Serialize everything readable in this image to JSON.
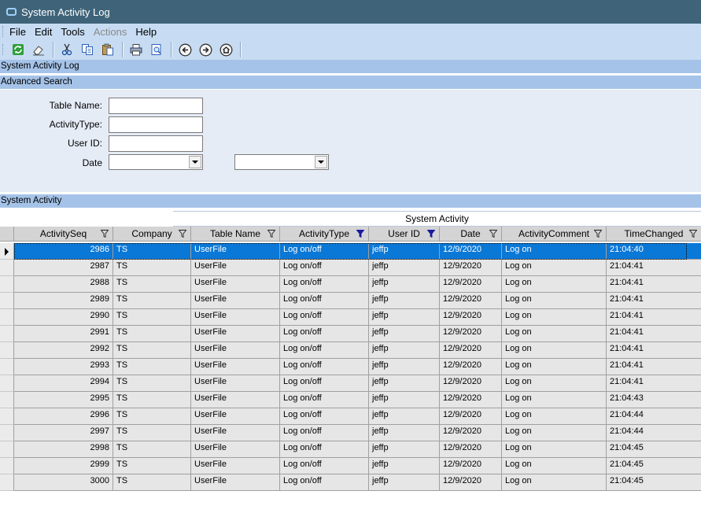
{
  "window": {
    "title": "System Activity Log"
  },
  "menu": [
    "File",
    "Edit",
    "Tools",
    "Actions",
    "Help"
  ],
  "toolbar": [
    "refresh-icon",
    "eraser-icon",
    "cut-icon",
    "copy-icon",
    "paste-icon",
    "print-icon",
    "print-preview-icon",
    "back-icon",
    "forward-icon",
    "home-icon"
  ],
  "bands": {
    "page_title": "System Activity Log",
    "advanced_search": "Advanced Search",
    "system_activity": "System Activity"
  },
  "search": {
    "table_name_label": "Table Name:",
    "activity_type_label": "ActivityType:",
    "user_id_label": "User ID:",
    "date_label": "Date",
    "table_name_value": "",
    "activity_type_value": "",
    "user_id_value": "",
    "date_from_value": "",
    "date_to_value": ""
  },
  "grid": {
    "caption": "System Activity",
    "columns": [
      "ActivitySeq",
      "Company",
      "Table Name",
      "ActivityType",
      "User ID",
      "Date",
      "ActivityComment",
      "TimeChanged"
    ],
    "filtered_columns": [
      3,
      4
    ],
    "selected_row": 0,
    "rows": [
      [
        "2986",
        "TS",
        "UserFile",
        "Log on/off",
        "jeffp",
        "12/9/2020",
        "Log on",
        "21:04:40"
      ],
      [
        "2987",
        "TS",
        "UserFile",
        "Log on/off",
        "jeffp",
        "12/9/2020",
        "Log on",
        "21:04:41"
      ],
      [
        "2988",
        "TS",
        "UserFile",
        "Log on/off",
        "jeffp",
        "12/9/2020",
        "Log on",
        "21:04:41"
      ],
      [
        "2989",
        "TS",
        "UserFile",
        "Log on/off",
        "jeffp",
        "12/9/2020",
        "Log on",
        "21:04:41"
      ],
      [
        "2990",
        "TS",
        "UserFile",
        "Log on/off",
        "jeffp",
        "12/9/2020",
        "Log on",
        "21:04:41"
      ],
      [
        "2991",
        "TS",
        "UserFile",
        "Log on/off",
        "jeffp",
        "12/9/2020",
        "Log on",
        "21:04:41"
      ],
      [
        "2992",
        "TS",
        "UserFile",
        "Log on/off",
        "jeffp",
        "12/9/2020",
        "Log on",
        "21:04:41"
      ],
      [
        "2993",
        "TS",
        "UserFile",
        "Log on/off",
        "jeffp",
        "12/9/2020",
        "Log on",
        "21:04:41"
      ],
      [
        "2994",
        "TS",
        "UserFile",
        "Log on/off",
        "jeffp",
        "12/9/2020",
        "Log on",
        "21:04:41"
      ],
      [
        "2995",
        "TS",
        "UserFile",
        "Log on/off",
        "jeffp",
        "12/9/2020",
        "Log on",
        "21:04:43"
      ],
      [
        "2996",
        "TS",
        "UserFile",
        "Log on/off",
        "jeffp",
        "12/9/2020",
        "Log on",
        "21:04:44"
      ],
      [
        "2997",
        "TS",
        "UserFile",
        "Log on/off",
        "jeffp",
        "12/9/2020",
        "Log on",
        "21:04:44"
      ],
      [
        "2998",
        "TS",
        "UserFile",
        "Log on/off",
        "jeffp",
        "12/9/2020",
        "Log on",
        "21:04:45"
      ],
      [
        "2999",
        "TS",
        "UserFile",
        "Log on/off",
        "jeffp",
        "12/9/2020",
        "Log on",
        "21:04:45"
      ],
      [
        "3000",
        "TS",
        "UserFile",
        "Log on/off",
        "jeffp",
        "12/9/2020",
        "Log on",
        "21:04:45"
      ]
    ]
  },
  "colors": {
    "titlebar": "#3f6479",
    "menubar": "#c7dcf3",
    "band": "#a5c3e8",
    "selection": "#0a78d7",
    "filter_active": "#1a1aa0"
  }
}
